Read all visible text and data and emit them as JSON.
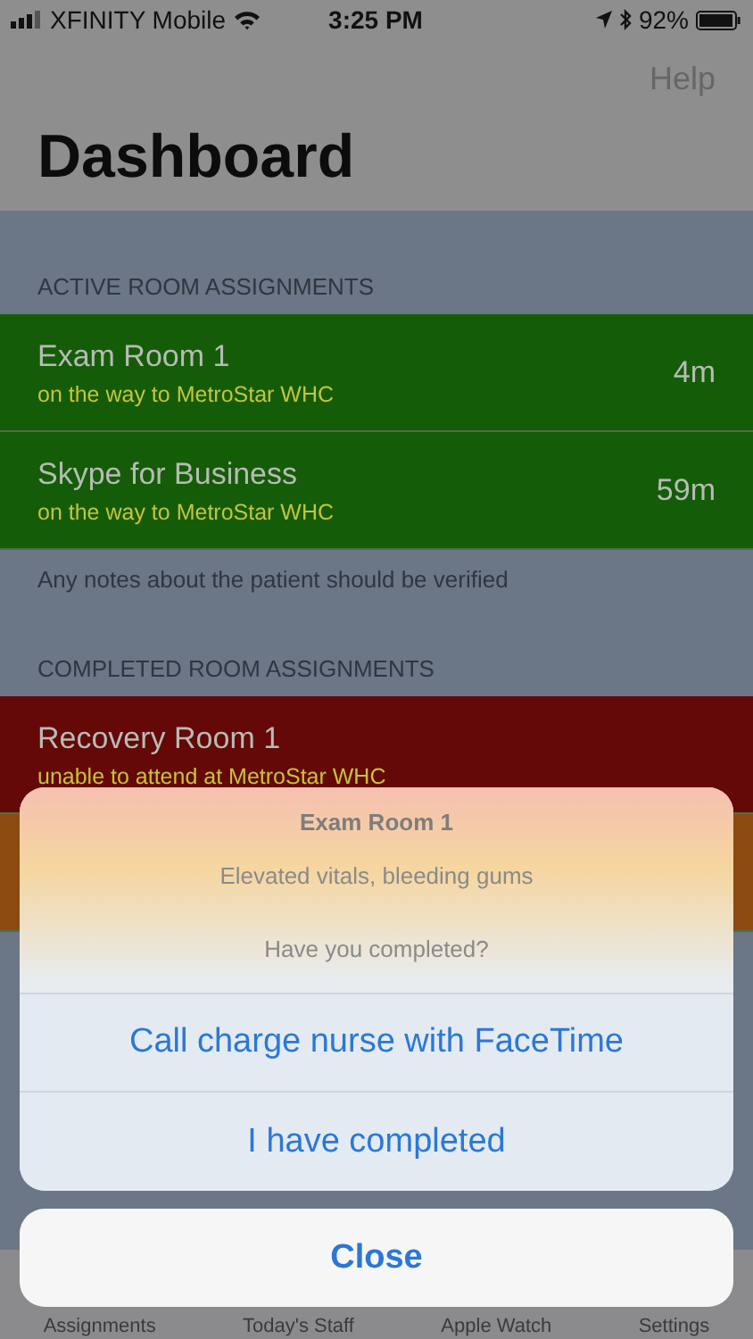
{
  "status_bar": {
    "carrier": "XFINITY Mobile",
    "time": "3:25 PM",
    "battery": "92%"
  },
  "nav": {
    "help": "Help",
    "title": "Dashboard"
  },
  "sections": [
    {
      "header": "ACTIVE ROOM ASSIGNMENTS",
      "rows": [
        {
          "title": "Exam Room 1",
          "subtitle": "on the way to MetroStar WHC",
          "time": "4m",
          "color": "#155c08"
        },
        {
          "title": "Skype for Business",
          "subtitle": "on the way to MetroStar WHC",
          "time": "59m",
          "color": "#155c08"
        }
      ],
      "footer": "Any notes about the patient should be verified"
    },
    {
      "header": "COMPLETED ROOM ASSIGNMENTS",
      "rows": [
        {
          "title": "Recovery Room 1",
          "subtitle": "unable to attend at MetroStar WHC",
          "color": "#650808"
        },
        {
          "color": "#8c4a10"
        }
      ]
    }
  ],
  "tab_bar": [
    "Assignments",
    "Today's Staff",
    "Apple Watch",
    "Settings"
  ],
  "action_sheet": {
    "title": "Exam Room 1",
    "message": "Elevated vitals, bleeding gums",
    "question": "Have you completed?",
    "actions": [
      "Call charge nurse with FaceTime",
      "I have completed"
    ],
    "cancel": "Close"
  }
}
